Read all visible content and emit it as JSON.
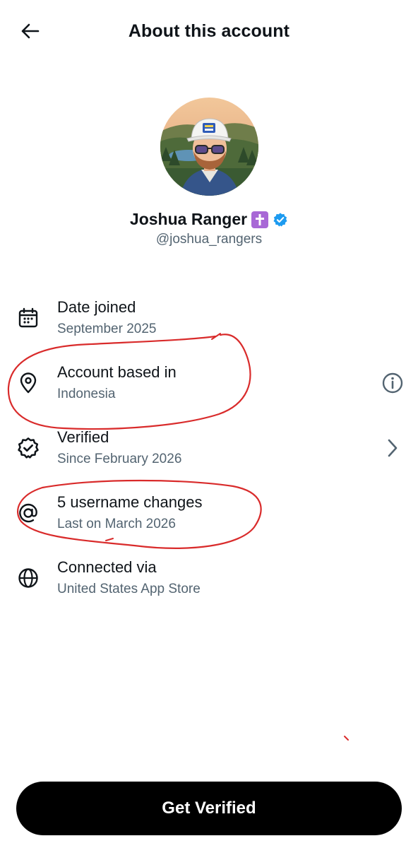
{
  "header": {
    "title": "About this account"
  },
  "profile": {
    "name": "Joshua Ranger",
    "handle": "@joshua_rangers",
    "badges": [
      "cross-emoji",
      "verified-badge"
    ]
  },
  "details": [
    {
      "icon": "calendar-icon",
      "title": "Date joined",
      "subtitle": "September 2025"
    },
    {
      "icon": "location-pin-icon",
      "title": "Account based in",
      "subtitle": "Indonesia",
      "trailing_icon": "info-icon"
    },
    {
      "icon": "verified-check-icon",
      "title": "Verified",
      "subtitle": "Since February 2026",
      "trailing_icon": "chevron-right-icon"
    },
    {
      "icon": "at-sign-icon",
      "title": "5 username changes",
      "subtitle": "Last on March 2026"
    },
    {
      "icon": "globe-icon",
      "title": "Connected via",
      "subtitle": "United States App Store"
    }
  ],
  "cta": {
    "label": "Get Verified"
  },
  "colors": {
    "text_primary": "#0f1419",
    "text_secondary": "#536471",
    "verified_blue": "#1d9bf0",
    "annotation_red": "#d92b2b",
    "cta_background": "#000000"
  }
}
